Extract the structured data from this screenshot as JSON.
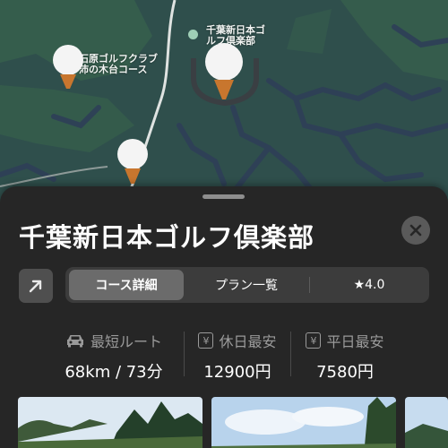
{
  "map": {
    "labels": [
      {
        "id": "club-label-main",
        "text": "千葉新日本ゴ\nルフ倶楽部"
      },
      {
        "id": "club-label-west",
        "text": "石原ゴルフクラブ\n沛の木台コース"
      }
    ]
  },
  "sheet": {
    "title": "千葉新日本ゴルフ倶楽部",
    "tabs": [
      {
        "label": "コース詳細",
        "active": true
      },
      {
        "label": "プラン一覧",
        "active": false
      },
      {
        "label": "★4.0",
        "active": false
      }
    ],
    "stats": [
      {
        "icon": "car-icon",
        "label": "最短ルート",
        "value": "68km / 73分"
      },
      {
        "icon": "yen-icon",
        "icon_glyph": "¥",
        "label": "休日最安",
        "value": "12900円"
      },
      {
        "icon": "yen-icon",
        "icon_glyph": "¥",
        "label": "平日最安",
        "value": "7580円"
      }
    ]
  },
  "colors": {
    "map_background": "#2f4f4c",
    "sheet_background": "#262626",
    "pin_tee": "#c8762e",
    "active_tab": "#6b6b6b"
  }
}
